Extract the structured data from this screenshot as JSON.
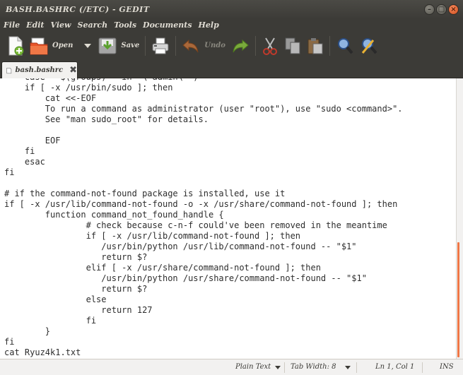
{
  "window": {
    "title": "BASH.BASHRC (/ETC) - GEDIT",
    "minimize_glyph": "–",
    "maximize_glyph": "□",
    "close_glyph": "×"
  },
  "menu": {
    "items": [
      "File",
      "Edit",
      "View",
      "Search",
      "Tools",
      "Documents",
      "Help"
    ]
  },
  "toolbar": {
    "open_label": "Open",
    "save_label": "Save",
    "undo_label": "Undo",
    "icons": [
      "new-document-icon",
      "open-folder-icon",
      "save-icon",
      "print-icon",
      "undo-icon",
      "redo-icon",
      "cut-icon",
      "copy-icon",
      "paste-icon",
      "find-icon",
      "find-replace-icon"
    ]
  },
  "tabs": [
    {
      "label": "bash.bashrc",
      "close_glyph": "✖"
    }
  ],
  "editor": {
    "lines": [
      "    case \" $(groups) \" in *\\ admin\\ *)",
      "    if [ -x /usr/bin/sudo ]; then",
      "        cat <<-EOF",
      "        To run a command as administrator (user \"root\"), use \"sudo <command>\".",
      "        See \"man sudo_root\" for details.",
      "",
      "        EOF",
      "    fi",
      "    esac",
      "fi",
      "",
      "# if the command-not-found package is installed, use it",
      "if [ -x /usr/lib/command-not-found -o -x /usr/share/command-not-found ]; then",
      "        function command_not_found_handle {",
      "                # check because c-n-f could've been removed in the meantime",
      "                if [ -x /usr/lib/command-not-found ]; then",
      "                   /usr/bin/python /usr/lib/command-not-found -- \"$1\"",
      "                   return $?",
      "                elif [ -x /usr/share/command-not-found ]; then",
      "                   /usr/bin/python /usr/share/command-not-found -- \"$1\"",
      "                   return $?",
      "                else",
      "                   return 127",
      "                fi",
      "        }",
      "fi",
      "cat Ryuz4k1.txt"
    ]
  },
  "statusbar": {
    "language": "Plain Text",
    "tab_width": "Tab Width:  8",
    "position": "Ln 1, Col 1",
    "mode": "INS"
  },
  "colors": {
    "accent": "#f07746",
    "chrome": "#3c3b37",
    "editor_bg": "#ffffff"
  }
}
